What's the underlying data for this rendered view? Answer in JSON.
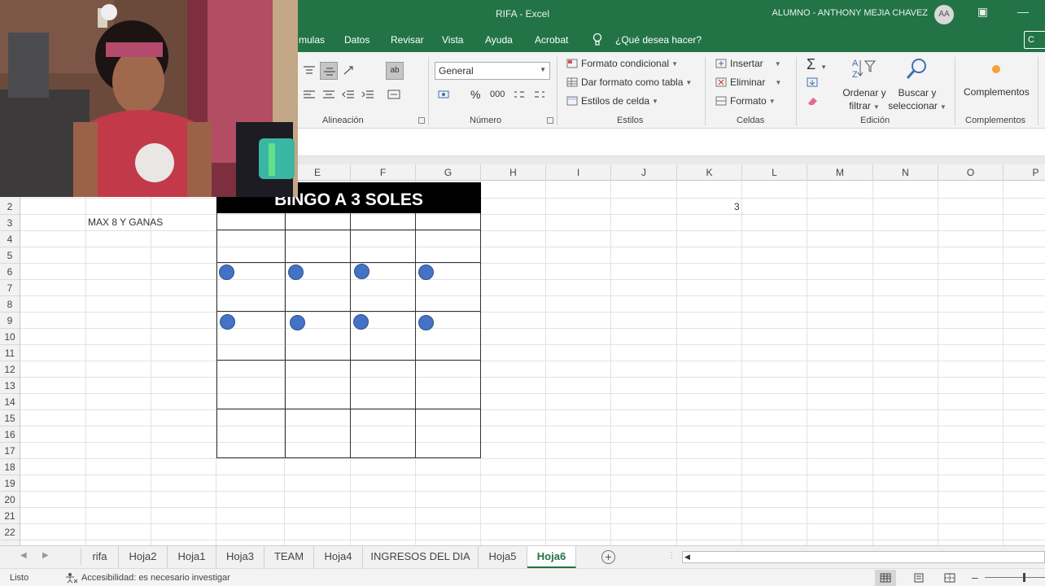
{
  "window": {
    "title": "RIFA  -  Excel",
    "user": "ALUMNO - ANTHONY MEJIA CHAVEZ",
    "avatar_initials": "AA"
  },
  "ribbon_tabs": [
    "mulas",
    "Datos",
    "Revisar",
    "Vista",
    "Ayuda",
    "Acrobat"
  ],
  "tell_me": "¿Qué desea hacer?",
  "share_label": "C",
  "ribbon": {
    "alineacion": {
      "label": "Alineación"
    },
    "numero": {
      "label": "Número",
      "format": "General",
      "percent": "%",
      "thousands": "000"
    },
    "estilos": {
      "label": "Estilos",
      "conditional": "Formato condicional",
      "as_table": "Dar formato como tabla",
      "cell_styles": "Estilos de celda"
    },
    "celdas": {
      "label": "Celdas",
      "insert": "Insertar",
      "delete": "Eliminar",
      "format": "Formato"
    },
    "edicion": {
      "label": "Edición",
      "sort_line1": "Ordenar y",
      "sort_line2": "filtrar",
      "find_line1": "Buscar y",
      "find_line2": "seleccionar"
    },
    "complementos": {
      "label": "Complementos",
      "button": "Complementos"
    }
  },
  "columns": [
    "E",
    "F",
    "G",
    "H",
    "I",
    "J",
    "K",
    "L",
    "M",
    "N",
    "O",
    "P"
  ],
  "rows": [
    "2",
    "3",
    "4",
    "5",
    "6",
    "7",
    "8",
    "9",
    "10",
    "11",
    "12",
    "13",
    "14",
    "15",
    "16",
    "17",
    "18",
    "19",
    "20",
    "21",
    "22"
  ],
  "cells": {
    "b3": "MAX 8 Y GANAS",
    "k2": "3"
  },
  "bingo": {
    "title": "BINGO A 3 SOLES",
    "circles_color": "#4472c4"
  },
  "sheets": {
    "tabs": [
      "rifa",
      "Hoja2",
      "Hoja1",
      "Hoja3",
      "TEAM",
      "Hoja4",
      "INGRESOS DEL DIA",
      "Hoja5",
      "Hoja6"
    ],
    "active": "Hoja6"
  },
  "status": {
    "ready": "Listo",
    "accessibility": "Accesibilidad: es necesario investigar"
  },
  "colors": {
    "excel_green": "#227447",
    "active_tab": "#217346"
  }
}
